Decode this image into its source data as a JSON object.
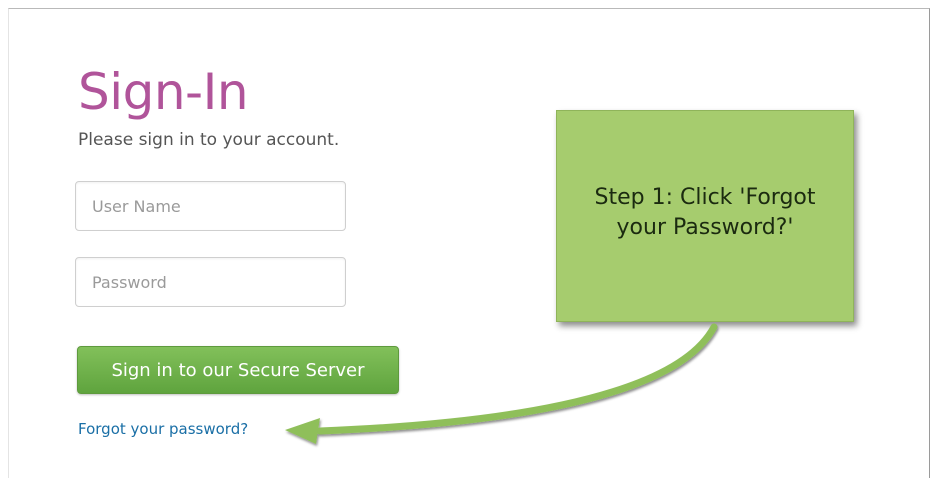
{
  "login": {
    "title": "Sign-In",
    "subtitle": "Please sign in to your account.",
    "username_placeholder": "User Name",
    "username_value": "",
    "password_placeholder": "Password",
    "password_value": "",
    "submit_label": "Sign in to our Secure Server",
    "forgot_label": "Forgot your password?"
  },
  "callout": {
    "line1": "Step 1: Click 'Forgot",
    "line2": "your Password?'"
  },
  "colors": {
    "title": "#b0549a",
    "button": "#6cb048",
    "link": "#1a6fa6",
    "callout": "#a6cc6e",
    "arrow": "#8fbf5a"
  }
}
